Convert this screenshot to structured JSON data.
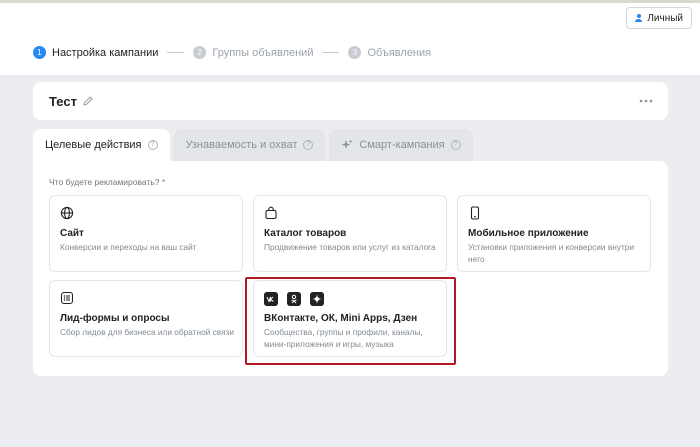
{
  "account": {
    "label": "Личный",
    "icon": "person-icon"
  },
  "steps": [
    {
      "num": "1",
      "label": "Настройка кампании"
    },
    {
      "num": "2",
      "label": "Группы объявлений"
    },
    {
      "num": "3",
      "label": "Объявления"
    }
  ],
  "campaign": {
    "title": "Тест",
    "edit_icon": "pencil-icon",
    "menu_icon": "more-dots-icon"
  },
  "tabs": [
    {
      "label": "Целевые действия",
      "help": "?"
    },
    {
      "label": "Узнаваемость и охват",
      "help": "?"
    },
    {
      "label": "Смарт-кампания",
      "help": "?"
    }
  ],
  "question": "Что будете рекламировать? *",
  "options": [
    {
      "title": "Сайт",
      "desc": "Конверсии и переходы на ваш сайт",
      "icon": "globe-icon"
    },
    {
      "title": "Каталог товаров",
      "desc": "Продвижение товаров или услуг из каталога",
      "icon": "shopping-bag-icon"
    },
    {
      "title": "Мобильное приложение",
      "desc": "Установки приложения и конверсии внутри него",
      "icon": "smartphone-icon"
    },
    {
      "title": "Лид-формы и опросы",
      "desc": "Сбор лидов для бизнеса или обратной связи",
      "icon": "form-list-icon"
    },
    {
      "title": "ВКонтакте, ОК, Mini Apps, Дзен",
      "desc": "Сообщества, группы и профили, каналы, мини-приложения и игры, музыка",
      "icons": [
        "vk-icon",
        "ok-icon",
        "dzen-icon"
      ]
    }
  ],
  "colors": {
    "accent": "#2787f5",
    "highlight": "#b11a23",
    "background": "#ebedf0"
  }
}
